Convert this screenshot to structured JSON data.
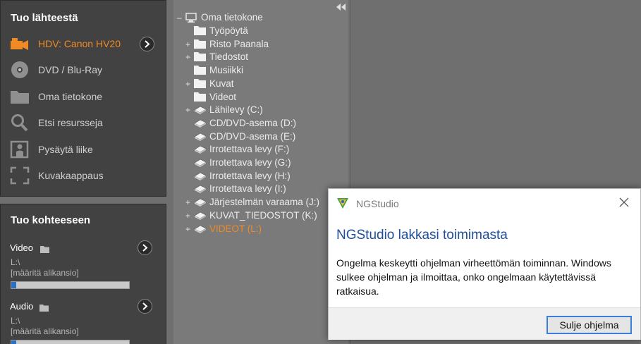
{
  "source_panel": {
    "title": "Tuo lähteestä",
    "items": [
      {
        "label": "HDV: Canon HV20",
        "icon": "camcorder-icon",
        "active": true
      },
      {
        "label": "DVD / Blu-Ray",
        "icon": "disc-icon"
      },
      {
        "label": "Oma tietokone",
        "icon": "folder-icon"
      },
      {
        "label": "Etsi resursseja",
        "icon": "search-icon"
      },
      {
        "label": "Pysäytä liike",
        "icon": "stop-motion-icon"
      },
      {
        "label": "Kuvakaappaus",
        "icon": "snapshot-frame-icon"
      }
    ]
  },
  "dest_panel": {
    "title": "Tuo kohteeseen",
    "groups": [
      {
        "label": "Video",
        "path": "L:\\",
        "subfolder": "[määritä alikansio]",
        "fill": 0.04
      },
      {
        "label": "Audio",
        "path": "L:\\",
        "subfolder": "[määritä alikansio]",
        "fill": 0.04
      }
    ]
  },
  "tree": {
    "root": "Oma tietokone",
    "items": [
      {
        "label": "Työpöytä",
        "toggle": "",
        "icon": "folder-icon"
      },
      {
        "label": "Risto Paanala",
        "toggle": "+",
        "icon": "folder-icon"
      },
      {
        "label": "Tiedostot",
        "toggle": "+",
        "icon": "folder-icon"
      },
      {
        "label": "Musiikki",
        "toggle": "",
        "icon": "folder-icon"
      },
      {
        "label": "Kuvat",
        "toggle": "+",
        "icon": "folder-icon"
      },
      {
        "label": "Videot",
        "toggle": "",
        "icon": "folder-icon"
      },
      {
        "label": "Lähilevy (C:)",
        "toggle": "+",
        "icon": "drive-icon"
      },
      {
        "label": "CD/DVD-asema (D:)",
        "toggle": "",
        "icon": "drive-icon"
      },
      {
        "label": "CD/DVD-asema (E:)",
        "toggle": "",
        "icon": "drive-icon"
      },
      {
        "label": "Irrotettava levy (F:)",
        "toggle": "",
        "icon": "drive-icon"
      },
      {
        "label": "Irrotettava levy (G:)",
        "toggle": "",
        "icon": "drive-icon"
      },
      {
        "label": "Irrotettava levy (H:)",
        "toggle": "",
        "icon": "drive-icon"
      },
      {
        "label": "Irrotettava levy (I:)",
        "toggle": "",
        "icon": "drive-icon"
      },
      {
        "label": "Järjestelmän varaama (J:)",
        "toggle": "+",
        "icon": "drive-icon"
      },
      {
        "label": "KUVAT_TIEDOSTOT (K:)",
        "toggle": "+",
        "icon": "drive-icon"
      },
      {
        "label": "VIDEOT (L:)",
        "toggle": "+",
        "icon": "drive-icon",
        "active": true
      }
    ]
  },
  "dialog": {
    "title": "NGStudio",
    "heading": "NGStudio lakkasi toimimasta",
    "message": "Ongelma keskeytti ohjelman virheettömän toiminnan. Windows sulkee ohjelman ja ilmoittaa, onko ongelmaan käytettävissä ratkaisua.",
    "button": "Sulje ohjelma"
  },
  "colors": {
    "accent": "#f08a24",
    "panel": "#424242",
    "link_blue": "#1f4e9c"
  }
}
